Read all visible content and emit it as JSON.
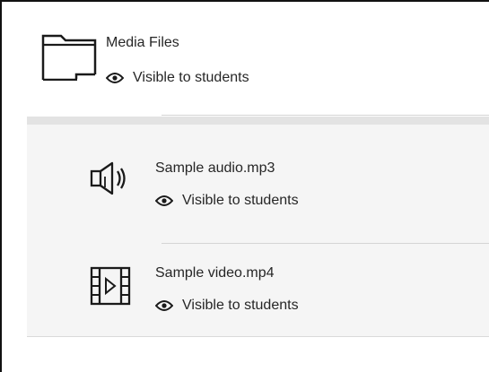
{
  "folder": {
    "title": "Media Files",
    "visibility": "Visible to students",
    "icon": "folder-icon"
  },
  "contents": [
    {
      "title": "Sample audio.mp3",
      "visibility": "Visible to students",
      "icon": "audio-file-icon"
    },
    {
      "title": "Sample video.mp4",
      "visibility": "Visible to students",
      "icon": "video-file-icon"
    }
  ],
  "colors": {
    "text": "#262626",
    "contents_background": "#f5f5f5",
    "separator": "#d4d4d4"
  }
}
